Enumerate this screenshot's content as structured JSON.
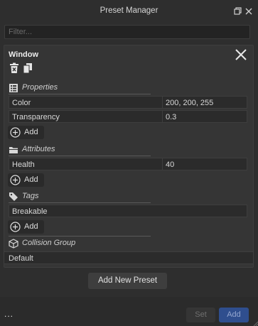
{
  "window": {
    "title": "Preset Manager"
  },
  "filter": {
    "placeholder": "Filter..."
  },
  "preset": {
    "name": "Window",
    "sections": {
      "properties": {
        "label": "Properties",
        "rows": [
          {
            "key": "Color",
            "value": "200, 200, 255"
          },
          {
            "key": "Transparency",
            "value": "0.3"
          }
        ],
        "add_label": "Add"
      },
      "attributes": {
        "label": "Attributes",
        "rows": [
          {
            "key": "Health",
            "value": "40"
          }
        ],
        "add_label": "Add"
      },
      "tags": {
        "label": "Tags",
        "rows": [
          {
            "key": "Breakable"
          }
        ],
        "add_label": "Add"
      },
      "collision_group": {
        "label": "Collision Group",
        "value": "Default"
      }
    }
  },
  "actions": {
    "add_new_preset": "Add New Preset",
    "more": "...",
    "set": "Set",
    "add": "Add"
  },
  "icons": {
    "maximize": "maximize-icon",
    "close_window": "close-icon",
    "delete": "trash-icon",
    "copy": "copy-icon",
    "properties": "properties-icon",
    "attributes": "folder-icon",
    "tags": "tag-icon",
    "collision": "cube-icon",
    "add": "plus-circle-icon"
  },
  "colors": {
    "background": "#2e2e2e",
    "panel": "#353535",
    "accent_button": "#2f4e8e"
  }
}
